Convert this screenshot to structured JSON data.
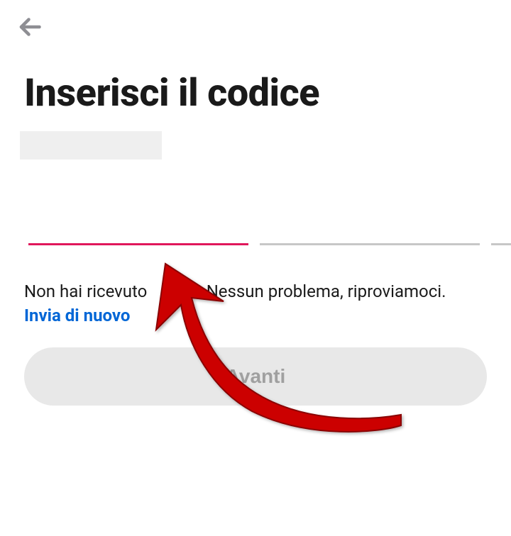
{
  "header": {
    "back_icon": "arrow-left"
  },
  "title": "Inserisci il codice",
  "code": {
    "slots": 6,
    "active_index": 0
  },
  "help": {
    "text_before": "Non hai ricevuto",
    "text_after": "Nessun problema, riproviamoci.",
    "resend_label": "Invia di nuovo"
  },
  "next_button_label": "Avanti",
  "colors": {
    "accent": "#e0175b",
    "link": "#0066d6",
    "disabled_bg": "#e8e8e8",
    "disabled_fg": "#a0a0a0",
    "annotation": "#cc0000"
  }
}
